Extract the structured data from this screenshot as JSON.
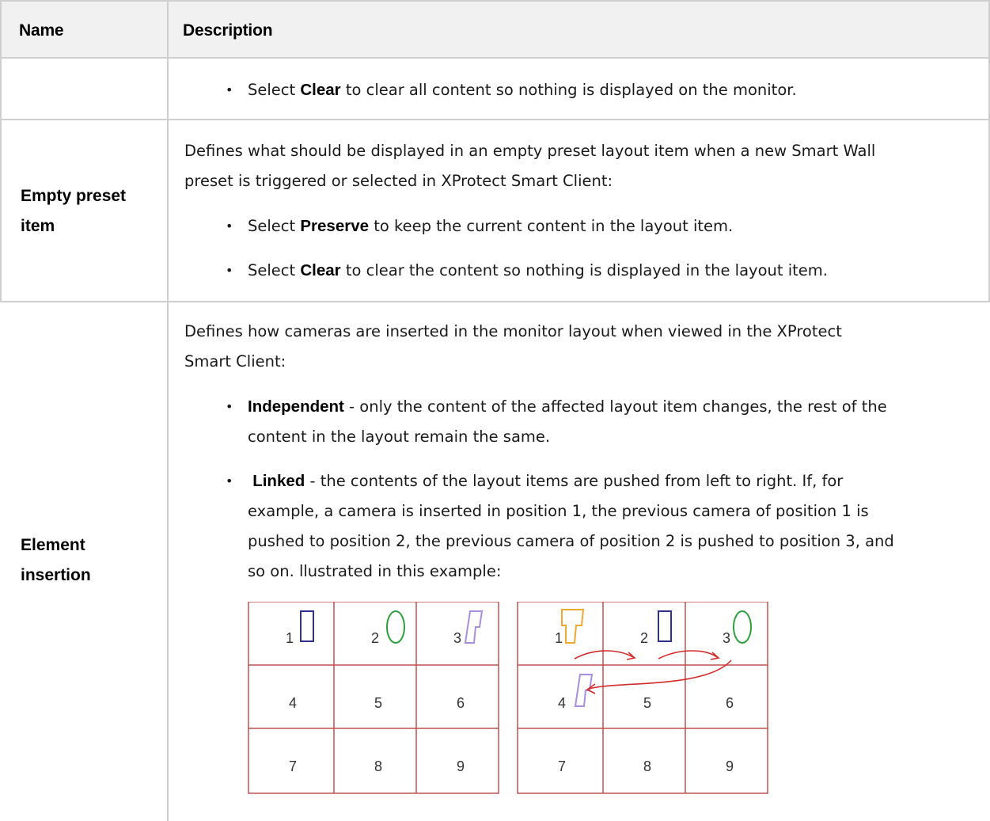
{
  "table": {
    "headers": {
      "name": "Name",
      "description": "Description"
    },
    "rows": [
      {
        "name": "",
        "bullets": [
          {
            "prefix": "Select ",
            "keyword": "Clear",
            "text": " to clear all content so nothing is displayed on the monitor."
          }
        ]
      },
      {
        "name": "Empty preset item",
        "name_lines": [
          "Empty preset",
          "item"
        ],
        "intro_lines": [
          "Defines what should be displayed in an empty preset layout item when a new Smart Wall",
          "preset is triggered or selected in XProtect Smart Client:"
        ],
        "bullets": [
          {
            "prefix": "Select ",
            "keyword": "Preserve",
            "text": " to keep the current content in the layout item."
          },
          {
            "prefix": "Select ",
            "keyword": "Clear",
            "text": " to clear the content so nothing is displayed in the layout item."
          }
        ]
      },
      {
        "name": "Element insertion",
        "name_lines": [
          "Element",
          "insertion"
        ],
        "intro_lines": [
          "Defines how cameras are inserted in the monitor layout when viewed in the XProtect",
          "Smart Client:"
        ],
        "bullets": [
          {
            "keyword": "Independent",
            "lines": [
              " - only the content of the affected layout item changes, the rest of the",
              "content in the layout remain the same."
            ]
          },
          {
            "keyword": "Linked",
            "lines": [
              " - the contents of the layout items are pushed from left to right. If, for",
              "example, a camera is inserted in position 1, the previous camera of position 1 is",
              "pushed to position 2, the previous camera of position 2 is pushed to position 3, and",
              "so on. llustrated in this example:"
            ]
          }
        ],
        "illustration": {
          "left_grid": [
            "1",
            "2",
            "3",
            "4",
            "5",
            "6",
            "7",
            "8",
            "9"
          ],
          "right_grid": [
            "1",
            "2",
            "3",
            "4",
            "5",
            "6",
            "7",
            "8",
            "9"
          ]
        }
      }
    ]
  },
  "colors": {
    "header_bg": "#f1f1f1",
    "grid_line": "#cfcfcf",
    "illus_border": "#c0504d",
    "shape_blue": "#2e3192",
    "shape_green": "#2e9e3e",
    "shape_purple": "#a98de0",
    "shape_orange": "#f0a830",
    "arrow_red": "#d22b2b"
  }
}
